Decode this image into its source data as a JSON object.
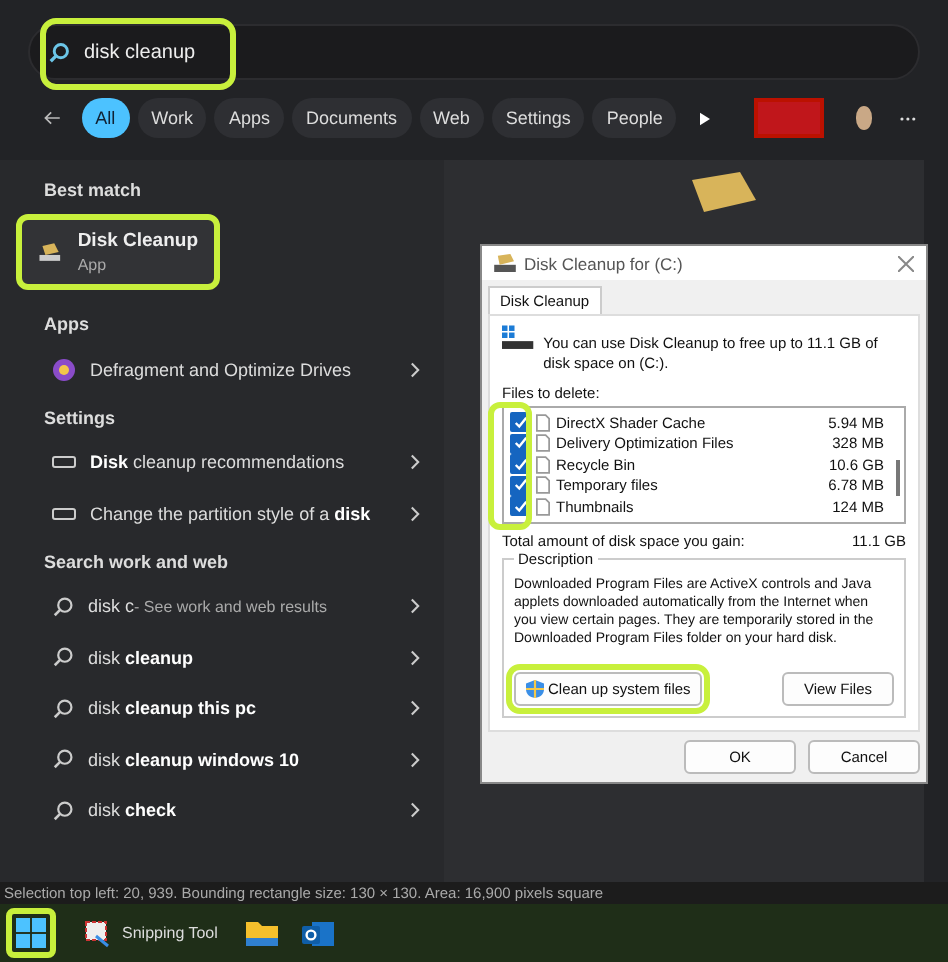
{
  "search": {
    "value": "disk cleanup"
  },
  "filters": [
    {
      "label": "All",
      "selected": true
    },
    {
      "label": "Work",
      "selected": false
    },
    {
      "label": "Apps",
      "selected": false
    },
    {
      "label": "Documents",
      "selected": false
    },
    {
      "label": "Web",
      "selected": false
    },
    {
      "label": "Settings",
      "selected": false
    },
    {
      "label": "People",
      "selected": false
    }
  ],
  "best_match": {
    "heading": "Best match",
    "title": "Disk Cleanup",
    "subtitle": "App"
  },
  "sections": [
    {
      "heading": "Apps",
      "items": [
        {
          "kind": "app",
          "text": "Defragment and Optimize Drives"
        }
      ]
    },
    {
      "heading": "Settings",
      "items": [
        {
          "kind": "setting",
          "text": "**Disk** cleanup recommendations"
        },
        {
          "kind": "setting",
          "text": "Change the partition style of a **disk**"
        }
      ]
    },
    {
      "heading": "Search work and web",
      "items": [
        {
          "kind": "web",
          "text": "disk c",
          "note": "- See work and web results"
        },
        {
          "kind": "web",
          "text": "disk **cleanup**"
        },
        {
          "kind": "web",
          "text": "disk **cleanup this pc**"
        },
        {
          "kind": "web",
          "text": "disk **cleanup windows 10**"
        },
        {
          "kind": "web",
          "text": "disk **check**"
        }
      ]
    }
  ],
  "dialog": {
    "title": "Disk Cleanup for  (C:)",
    "tab": "Disk Cleanup",
    "intro": "You can use Disk Cleanup to free up to 11.1 GB of disk space on  (C:).",
    "files_label": "Files to delete:",
    "files": [
      {
        "name": "DirectX Shader Cache",
        "size": "5.94 MB",
        "checked": true
      },
      {
        "name": "Delivery Optimization Files",
        "size": "328 MB",
        "checked": true
      },
      {
        "name": "Recycle Bin",
        "size": "10.6 GB",
        "checked": true
      },
      {
        "name": "Temporary files",
        "size": "6.78 MB",
        "checked": true
      },
      {
        "name": "Thumbnails",
        "size": "124 MB",
        "checked": true
      }
    ],
    "total_label": "Total amount of disk space you gain:",
    "total_value": "11.1 GB",
    "description_title": "Description",
    "description": "Downloaded Program Files are ActiveX controls and Java applets downloaded automatically from the Internet when you view certain pages. They are temporarily stored in the Downloaded Program Files folder on your hard disk.",
    "cleanup_button": "Clean up system files",
    "view_button": "View Files",
    "ok_button": "OK",
    "cancel_button": "Cancel"
  },
  "status_text": "Selection top left: 20, 939. Bounding rectangle size: 130 × 130. Area: 16,900 pixels square",
  "taskbar": [
    {
      "kind": "start"
    },
    {
      "kind": "snipping",
      "label": "Snipping Tool"
    },
    {
      "kind": "folder"
    },
    {
      "kind": "mail"
    }
  ]
}
